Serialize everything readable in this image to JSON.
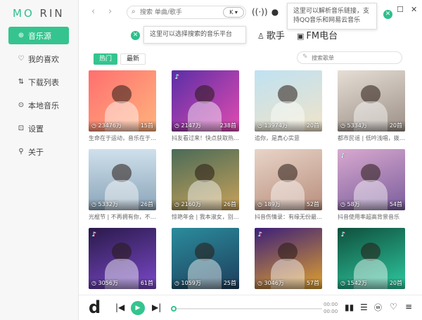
{
  "app": {
    "logo_left": "MO",
    "logo_right": "RIN"
  },
  "sidebar": {
    "items": [
      {
        "label": "音乐源",
        "icon": "plus-circle-icon",
        "active": true
      },
      {
        "label": "我的喜欢",
        "icon": "heart-icon",
        "active": false
      },
      {
        "label": "下载列表",
        "icon": "sort-icon",
        "active": false
      },
      {
        "label": "本地音乐",
        "icon": "play-circle-icon",
        "active": false
      },
      {
        "label": "设置",
        "icon": "settings-icon",
        "active": false
      },
      {
        "label": "关于",
        "icon": "location-icon",
        "active": false
      }
    ]
  },
  "topbar": {
    "search_placeholder": "搜索 单曲/歌手",
    "platform_label": "K ▾"
  },
  "tooltips": {
    "platform": "这里可以选择搜索的音乐平台",
    "link": "这里可以解析音乐链接，支持QQ音乐和网易云音乐"
  },
  "categories": [
    {
      "label": "歌手",
      "icon": "singer-icon"
    },
    {
      "label": "FM电台",
      "icon": "radio-icon"
    }
  ],
  "filters": {
    "hot": "热门",
    "new": "最新",
    "search_placeholder": "搜索歌单"
  },
  "playlists": [
    {
      "title": "生命在于运动，音乐在于节...",
      "plays": "23476万",
      "count": "15首",
      "tiktok": false,
      "bg": "linear-gradient(135deg,#ff6f6f,#ffb37d)"
    },
    {
      "title": "抖友看过来！快点获取热门...",
      "plays": "2147万",
      "count": "238首",
      "tiktok": true,
      "bg": "linear-gradient(135deg,#5a2ea6,#e04bb0)"
    },
    {
      "title": "追你，是真心实意",
      "plays": "13974万",
      "count": "20首",
      "tiktok": false,
      "bg": "linear-gradient(160deg,#bfe2f2,#f0e3c8)"
    },
    {
      "title": "都市民谣 | 低吟浅唱，拨动...",
      "plays": "5334万",
      "count": "20首",
      "tiktok": false,
      "bg": "linear-gradient(160deg,#e6ded6,#9b8f86)"
    },
    {
      "title": "光棍节 | 不再拥有你，不如...",
      "plays": "5332万",
      "count": "26首",
      "tiktok": false,
      "bg": "linear-gradient(180deg,#cfe0ec,#8aa4b8)"
    },
    {
      "title": "惊艳年会 | 我本淑女，别逼...",
      "plays": "2160万",
      "count": "26首",
      "tiktok": false,
      "bg": "linear-gradient(160deg,#4a6b57,#c9a25a)"
    },
    {
      "title": "抖音伤情录：有缘无份最是...",
      "plays": "189万",
      "count": "52首",
      "tiktok": false,
      "bg": "linear-gradient(160deg,#e8d4c8,#b88e7c)"
    },
    {
      "title": "抖音使用率超高背景音乐",
      "plays": "58万",
      "count": "54首",
      "tiktok": true,
      "bg": "linear-gradient(160deg,#d8a9cf,#7a5d9c)"
    },
    {
      "title": "",
      "plays": "3056万",
      "count": "61首",
      "tiktok": true,
      "bg": "linear-gradient(160deg,#2a1a4a,#7a48c8)"
    },
    {
      "title": "",
      "plays": "1059万",
      "count": "25首",
      "tiktok": false,
      "bg": "linear-gradient(160deg,#2b8c9c,#1d3e5c)"
    },
    {
      "title": "",
      "plays": "3046万",
      "count": "57首",
      "tiktok": true,
      "bg": "linear-gradient(160deg,#3c1f7a,#e0a12e)"
    },
    {
      "title": "",
      "plays": "1542万",
      "count": "20首",
      "tiktok": true,
      "bg": "linear-gradient(160deg,#0f4f3c,#2ec9a0)"
    }
  ],
  "player": {
    "logo": "d",
    "time_current": "00:00",
    "time_total": "00:00"
  }
}
